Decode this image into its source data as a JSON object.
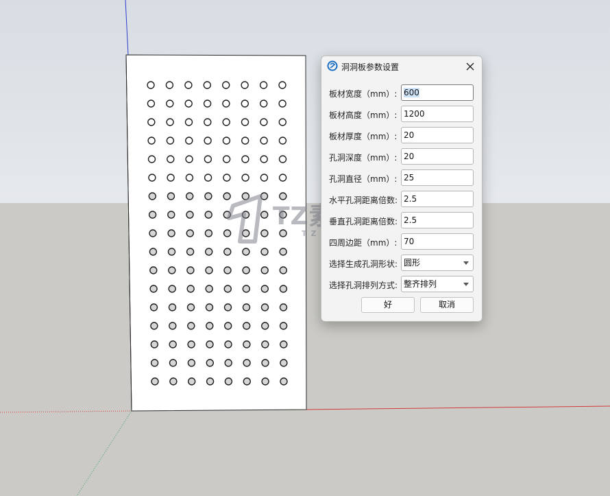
{
  "dialog": {
    "title": "洞洞板参数设置",
    "close_icon": "close-icon",
    "app_icon": "sketchup-logo-icon",
    "fields": [
      {
        "label": "板材宽度（mm）:",
        "value": "600"
      },
      {
        "label": "板材高度（mm）:",
        "value": "1200"
      },
      {
        "label": "板材厚度（mm）:",
        "value": "20"
      },
      {
        "label": "孔洞深度（mm）:",
        "value": "20"
      },
      {
        "label": "孔洞直径（mm）:",
        "value": "25"
      },
      {
        "label": "水平孔洞距离倍数:",
        "value": "2.5"
      },
      {
        "label": "垂直孔洞距离倍数:",
        "value": "2.5"
      },
      {
        "label": "四周边距（mm）:",
        "value": "70"
      }
    ],
    "selects": [
      {
        "label": "选择生成孔洞形状:",
        "value": "圆形"
      },
      {
        "label": "选择孔洞排列方式:",
        "value": "整齐排列"
      }
    ],
    "ok_label": "好",
    "cancel_label": "取消"
  },
  "board": {
    "columns": 8,
    "rows": 17
  },
  "watermark": {
    "title": "TZ素材网",
    "subtitle": "TZSUCAI.COM"
  },
  "colors": {
    "accent_blue": "#1a6fc4",
    "axis_red": "#d33a3a",
    "axis_green": "#3aa35a",
    "axis_blue": "#2c3ccf"
  }
}
